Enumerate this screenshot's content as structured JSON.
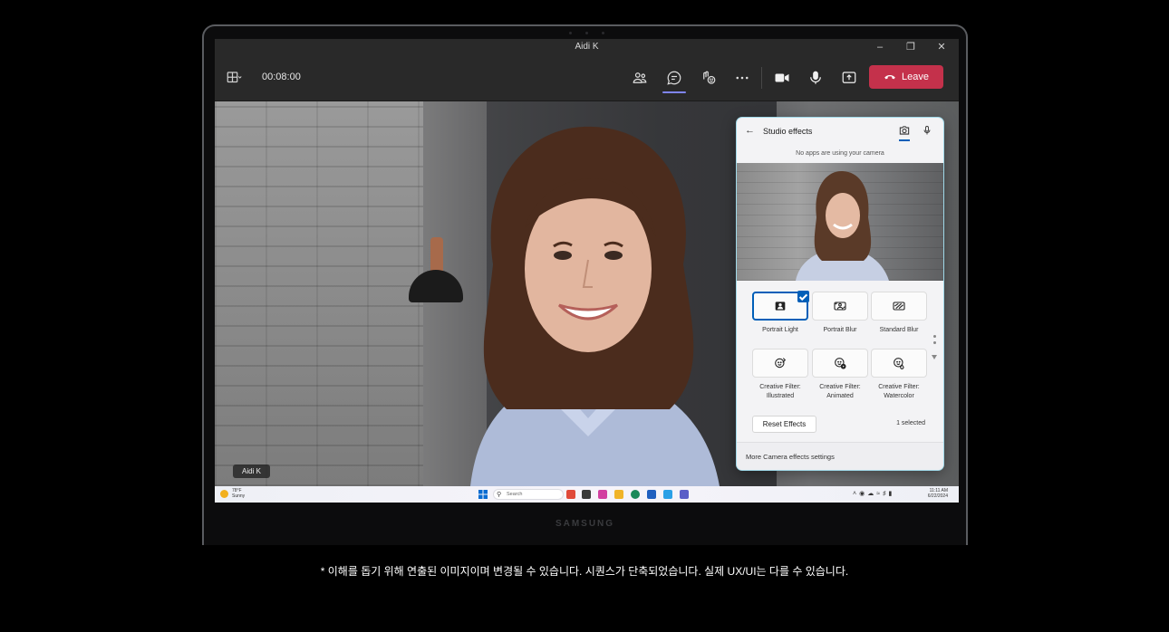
{
  "window": {
    "title": "Aidi K"
  },
  "toolbar": {
    "timer": "00:08:00",
    "leave_label": "Leave"
  },
  "video": {
    "participant_name": "Aidi K"
  },
  "studio_effects": {
    "title": "Studio effects",
    "camera_status": "No apps are using your camera",
    "effects": [
      {
        "label_line1": "Portrait Light",
        "label_line2": "",
        "selected": true
      },
      {
        "label_line1": "Portrait Blur",
        "label_line2": "",
        "selected": false
      },
      {
        "label_line1": "Standard Blur",
        "label_line2": "",
        "selected": false
      },
      {
        "label_line1": "Creative Filter:",
        "label_line2": "Illustrated",
        "selected": false
      },
      {
        "label_line1": "Creative Filter:",
        "label_line2": "Animated",
        "selected": false
      },
      {
        "label_line1": "Creative Filter:",
        "label_line2": "Watercolor",
        "selected": false
      }
    ],
    "reset_label": "Reset Effects",
    "selected_count": "1 selected",
    "footer_link": "More Camera effects settings"
  },
  "taskbar": {
    "weather_temp": "78°F",
    "weather_desc": "Sunny",
    "search_placeholder": "Search",
    "time": "11:11 AM",
    "date": "6/22/2024"
  },
  "device": {
    "brand": "SAMSUNG"
  },
  "disclaimer": "* 이해를 돕기 위해 연출된 이미지이며 변경될 수 있습니다. 시퀀스가 단축되었습니다. 실제 UX/UI는 다를 수 있습니다.",
  "colors": {
    "leave": "#c4314b",
    "accent": "#7f85f5",
    "selection": "#005fb8"
  }
}
